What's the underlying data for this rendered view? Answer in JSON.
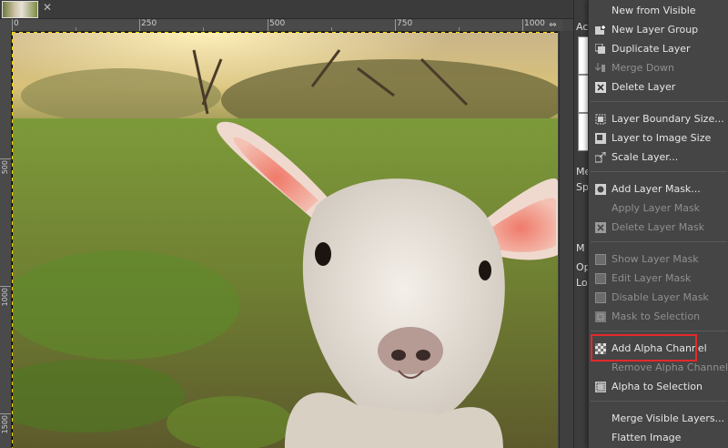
{
  "ruler": {
    "top_labels": [
      "0",
      "250",
      "500",
      "750",
      "1000"
    ],
    "left_labels": [
      "500",
      "1000",
      "1500",
      "2000"
    ]
  },
  "dock": {
    "fragments": [
      "Ac",
      "Me",
      "Sp",
      "M",
      "Op",
      "Lo"
    ]
  },
  "menu": {
    "items": [
      {
        "label": "New from Visible",
        "icon": "new-from-visible-icon",
        "enabled": true
      },
      {
        "label": "New Layer Group",
        "icon": "new-layer-group-icon",
        "enabled": true
      },
      {
        "label": "Duplicate Layer",
        "icon": "duplicate-layer-icon",
        "enabled": true
      },
      {
        "label": "Merge Down",
        "icon": "merge-down-icon",
        "enabled": false
      },
      {
        "label": "Delete Layer",
        "icon": "delete-layer-icon",
        "enabled": true
      },
      {
        "label": "Layer Boundary Size...",
        "icon": "layer-boundary-icon",
        "enabled": true
      },
      {
        "label": "Layer to Image Size",
        "icon": "layer-to-image-icon",
        "enabled": true
      },
      {
        "label": "Scale Layer...",
        "icon": "scale-layer-icon",
        "enabled": true
      },
      {
        "label": "Add Layer Mask...",
        "icon": "add-layer-mask-icon",
        "enabled": true
      },
      {
        "label": "Apply Layer Mask",
        "icon": "",
        "enabled": false
      },
      {
        "label": "Delete Layer Mask",
        "icon": "delete-layer-mask-icon",
        "enabled": false
      },
      {
        "label": "Show Layer Mask",
        "icon": "checkbox-icon",
        "enabled": false
      },
      {
        "label": "Edit Layer Mask",
        "icon": "checkbox-icon",
        "enabled": false
      },
      {
        "label": "Disable Layer Mask",
        "icon": "checkbox-icon",
        "enabled": false
      },
      {
        "label": "Mask to Selection",
        "icon": "mask-to-selection-icon",
        "enabled": false
      },
      {
        "label": "Add Alpha Channel",
        "icon": "checkerboard-icon",
        "enabled": true
      },
      {
        "label": "Remove Alpha Channel",
        "icon": "",
        "enabled": false
      },
      {
        "label": "Alpha to Selection",
        "icon": "alpha-to-selection-icon",
        "enabled": true
      },
      {
        "label": "Merge Visible Layers...",
        "icon": "",
        "enabled": true
      },
      {
        "label": "Flatten Image",
        "icon": "",
        "enabled": true
      }
    ]
  },
  "colors": {
    "highlight": "#e5282a",
    "menu_bg": "#454545",
    "disabled_text": "#8f8f8f"
  }
}
